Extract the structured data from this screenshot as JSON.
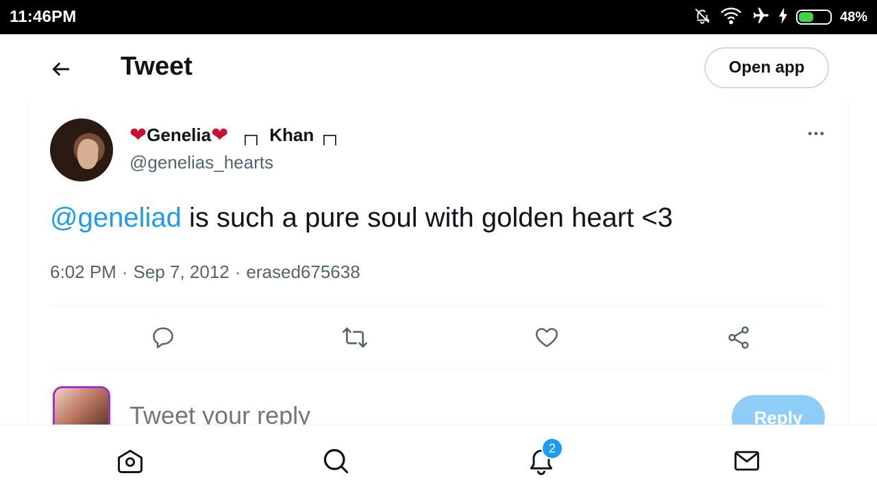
{
  "status_bar": {
    "time": "11:46PM",
    "battery_percent": "48%",
    "battery_level": 0.48,
    "icons": [
      "bell-off-icon",
      "wifi-icon",
      "airplane-icon",
      "charging-icon",
      "battery-icon"
    ],
    "battery_color": "#3fd24a"
  },
  "header": {
    "title": "Tweet",
    "back_icon": "arrow-left-icon",
    "open_app_label": "Open app"
  },
  "tweet": {
    "author_name_prefix": "Genelia",
    "author_name_suffix": "Khan",
    "author_handle": "@genelias_hearts",
    "mention": "@geneliad",
    "text": " is such a pure soul with golden heart <3",
    "time": "6:02 PM",
    "date": "Sep 7, 2012",
    "source": "erased675638",
    "separator": "·",
    "more_icon": "more-horizontal-icon"
  },
  "actions": [
    {
      "name": "reply",
      "icon": "comment-icon"
    },
    {
      "name": "retweet",
      "icon": "retweet-icon"
    },
    {
      "name": "like",
      "icon": "heart-icon"
    },
    {
      "name": "share",
      "icon": "share-icon"
    }
  ],
  "reply_box": {
    "placeholder": "Tweet your reply",
    "button_label": "Reply"
  },
  "bottom_nav": {
    "items": [
      "home-icon",
      "search-icon",
      "notifications-icon",
      "messages-icon"
    ],
    "notification_count": "2"
  },
  "colors": {
    "accent": "#1d9bf0",
    "reply_button": "#8ecdf8",
    "heart": "#c8102e",
    "secondary_text": "#536471"
  }
}
